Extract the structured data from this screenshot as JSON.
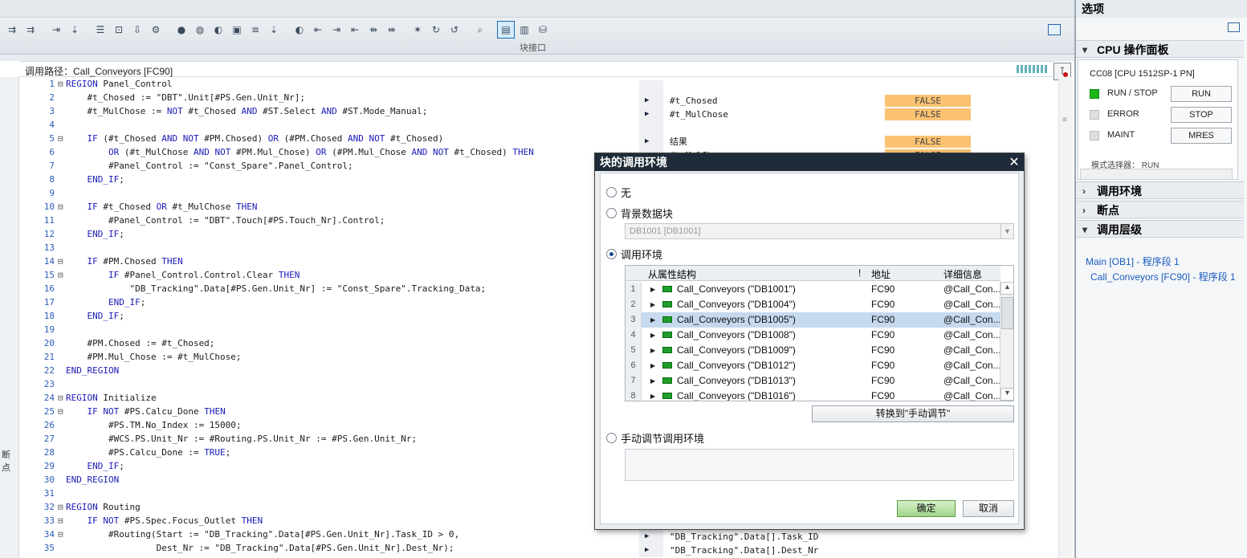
{
  "toolbar": {
    "caption": "块接口",
    "icons": [
      "align-icon",
      "align-icon",
      "export-icon",
      "goto-icon",
      "indent-icon",
      "monitor-icon",
      "download-icon",
      "compile-icon",
      "breakpoint-icon",
      "breakpoint-clear-icon",
      "watch-icon",
      "watch-list-icon",
      "stack-icon",
      "step-icon",
      "navigate-icon",
      "indent-more-icon",
      "indent-less-icon",
      "outdent-icon",
      "comment-icon",
      "uncomment-icon",
      "snippet-icon",
      "refresh-icon",
      "rewind-icon",
      "search-icon",
      "block-interface-icon",
      "compare-icon",
      "database-icon"
    ]
  },
  "editor": {
    "call_path_label": "调用路径：Call_Conveyors [FC90]",
    "gutter_label": "断点",
    "code_lines": [
      {
        "n": "1",
        "fold": "⊟",
        "text": "REGION Panel_Control"
      },
      {
        "n": "2",
        "fold": "",
        "text": "    #t_Chosed := \"DBT\".Unit[#PS.Gen.Unit_Nr];"
      },
      {
        "n": "3",
        "fold": "",
        "text": "    #t_MulChose := NOT #t_Chosed AND #ST.Select AND #ST.Mode_Manual;"
      },
      {
        "n": "4",
        "fold": "",
        "text": ""
      },
      {
        "n": "5",
        "fold": "⊟",
        "text": "    IF (#t_Chosed AND NOT #PM.Chosed) OR (#PM.Chosed AND NOT #t_Chosed)"
      },
      {
        "n": "6",
        "fold": "",
        "text": "        OR (#t_MulChose AND NOT #PM.Mul_Chose) OR (#PM.Mul_Chose AND NOT #t_Chosed) THEN"
      },
      {
        "n": "7",
        "fold": "",
        "text": "        #Panel_Control := \"Const_Spare\".Panel_Control;"
      },
      {
        "n": "8",
        "fold": "",
        "text": "    END_IF;"
      },
      {
        "n": "9",
        "fold": "",
        "text": ""
      },
      {
        "n": "10",
        "fold": "⊟",
        "text": "    IF #t_Chosed OR #t_MulChose THEN"
      },
      {
        "n": "11",
        "fold": "",
        "text": "        #Panel_Control := \"DBT\".Touch[#PS.Touch_Nr].Control;"
      },
      {
        "n": "12",
        "fold": "",
        "text": "    END_IF;"
      },
      {
        "n": "13",
        "fold": "",
        "text": ""
      },
      {
        "n": "14",
        "fold": "⊟",
        "text": "    IF #PM.Chosed THEN"
      },
      {
        "n": "15",
        "fold": "⊟",
        "text": "        IF #Panel_Control.Control.Clear THEN"
      },
      {
        "n": "16",
        "fold": "",
        "text": "            \"DB_Tracking\".Data[#PS.Gen.Unit_Nr] := \"Const_Spare\".Tracking_Data;"
      },
      {
        "n": "17",
        "fold": "",
        "text": "        END_IF;"
      },
      {
        "n": "18",
        "fold": "",
        "text": "    END_IF;"
      },
      {
        "n": "19",
        "fold": "",
        "text": ""
      },
      {
        "n": "20",
        "fold": "",
        "text": "    #PM.Chosed := #t_Chosed;"
      },
      {
        "n": "21",
        "fold": "",
        "text": "    #PM.Mul_Chose := #t_MulChose;"
      },
      {
        "n": "22",
        "fold": "",
        "text": "END_REGION"
      },
      {
        "n": "23",
        "fold": "",
        "text": ""
      },
      {
        "n": "24",
        "fold": "⊟",
        "text": "REGION Initialize"
      },
      {
        "n": "25",
        "fold": "⊟",
        "text": "    IF NOT #PS.Calcu_Done THEN"
      },
      {
        "n": "26",
        "fold": "",
        "text": "        #PS.TM.No_Index := 15000;"
      },
      {
        "n": "27",
        "fold": "",
        "text": "        #WCS.PS.Unit_Nr := #Routing.PS.Unit_Nr := #PS.Gen.Unit_Nr;"
      },
      {
        "n": "28",
        "fold": "",
        "text": "        #PS.Calcu_Done := TRUE;"
      },
      {
        "n": "29",
        "fold": "",
        "text": "    END_IF;"
      },
      {
        "n": "30",
        "fold": "",
        "text": "END_REGION"
      },
      {
        "n": "31",
        "fold": "",
        "text": ""
      },
      {
        "n": "32",
        "fold": "⊟",
        "text": "REGION Routing"
      },
      {
        "n": "33",
        "fold": "⊟",
        "text": "    IF NOT #PS.Spec.Focus_Outlet THEN"
      },
      {
        "n": "34",
        "fold": "⊟",
        "text": "        #Routing(Start := \"DB_Tracking\".Data[#PS.Gen.Unit_Nr].Task_ID > 0,"
      },
      {
        "n": "35",
        "fold": "",
        "text": "                 Dest_Nr := \"DB_Tracking\".Data[#PS.Gen.Unit_Nr].Dest_Nr);"
      }
    ],
    "monitor_rows": [
      {
        "arrow": "",
        "name": "",
        "value": "",
        "grey": false
      },
      {
        "arrow": "▶",
        "name": "#t_Chosed",
        "value": "FALSE",
        "grey": false
      },
      {
        "arrow": "▶",
        "name": "#t_MulChose",
        "value": "FALSE",
        "grey": false
      },
      {
        "arrow": "",
        "name": "",
        "value": "",
        "grey": false
      },
      {
        "arrow": "▶",
        "name": "结果",
        "value": "FALSE",
        "grey": false
      },
      {
        "arrow": "▶",
        "name": "#t_MulCh",
        "value": "FALSE",
        "grey": false
      }
    ],
    "monitor_bottom_rows": [
      {
        "arrow": "▶",
        "name": "\"DB_Tracking\".Data[].Task_ID"
      },
      {
        "arrow": "▶",
        "name": "\"DB_Tracking\".Data[].Dest_Nr"
      }
    ]
  },
  "options_pane": {
    "title": "选项",
    "cpu_panel": {
      "header": "CPU 操作面板",
      "cpu_name": "CC08 [CPU 1512SP-1 PN]",
      "run_stop_label": "RUN / STOP",
      "error_label": "ERROR",
      "maint_label": "MAINT",
      "run_button": "RUN",
      "stop_button": "STOP",
      "mres_button": "MRES",
      "mode_selector_label": "模式选择器：",
      "mode_selector_value": "RUN",
      "run_led_color": "#18b818"
    },
    "call_env_header": "调用环境",
    "breakpoints_header": "断点",
    "call_hierarchy_header": "调用层级",
    "call_hierarchy": [
      "Main [OB1] - 程序段 1",
      "Call_Conveyors [FC90] - 程序段 1"
    ]
  },
  "dialog": {
    "title": "块的调用环境",
    "close_glyph": "✕",
    "option_none": "无",
    "option_instance_db": "背景数据块",
    "instance_db_value": "DB1001 [DB1001]",
    "option_call_env": "调用环境",
    "selected_option": "调用环境",
    "grid_headers": {
      "structure": "从属性结构",
      "flag": "!",
      "address": "地址",
      "details": "详细信息"
    },
    "rows": [
      {
        "num": "1",
        "name": "Call_Conveyors (\"DB1001\")",
        "address": "FC90",
        "details": "@Call_Con..."
      },
      {
        "num": "2",
        "name": "Call_Conveyors (\"DB1004\")",
        "address": "FC90",
        "details": "@Call_Con..."
      },
      {
        "num": "3",
        "name": "Call_Conveyors (\"DB1005\")",
        "address": "FC90",
        "details": "@Call_Con..."
      },
      {
        "num": "4",
        "name": "Call_Conveyors (\"DB1008\")",
        "address": "FC90",
        "details": "@Call_Con..."
      },
      {
        "num": "5",
        "name": "Call_Conveyors (\"DB1009\")",
        "address": "FC90",
        "details": "@Call_Con..."
      },
      {
        "num": "6",
        "name": "Call_Conveyors (\"DB1012\")",
        "address": "FC90",
        "details": "@Call_Con..."
      },
      {
        "num": "7",
        "name": "Call_Conveyors (\"DB1013\")",
        "address": "FC90",
        "details": "@Call_Con..."
      },
      {
        "num": "8",
        "name": "Call_Conveyors (\"DB1016\")",
        "address": "FC90",
        "details": "@Call_Con..."
      }
    ],
    "selected_row": "3",
    "switch_button": "转换到\"手动调节\"",
    "option_manual": "手动调节调用环境",
    "ok_button": "确定",
    "cancel_button": "取消"
  }
}
